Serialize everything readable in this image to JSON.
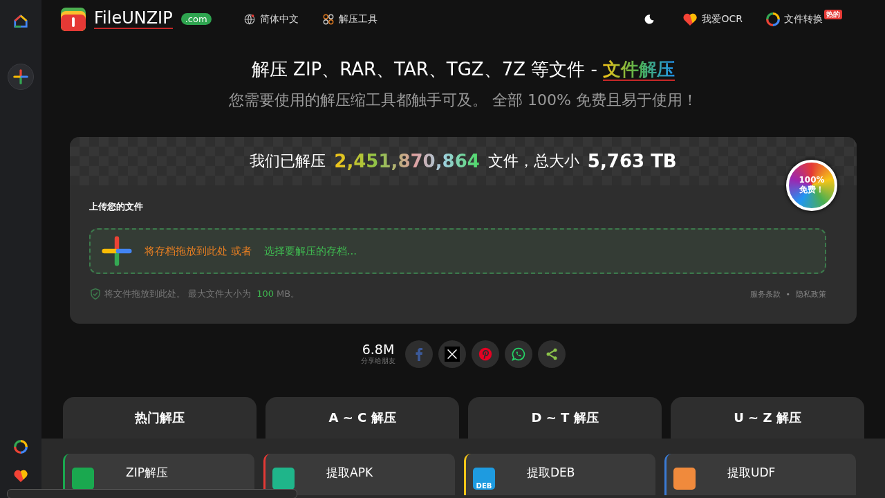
{
  "header": {
    "logo": {
      "name": "FileUNZIP",
      "tld": ".com"
    },
    "nav": [
      {
        "kind": "globe",
        "label": "简体中文"
      },
      {
        "kind": "tools",
        "label": "解压工具"
      }
    ],
    "links": [
      {
        "kind": "heart",
        "label": "我爱OCR"
      },
      {
        "kind": "convert",
        "label": "文件转换",
        "badge": "热的"
      }
    ]
  },
  "hero": {
    "title": "解压 ZIP、RAR、TAR、TGZ、7Z 等文件 - ",
    "highlight": "文件解压",
    "subtitle": "您需要使用的解压缩工具都触手可及。 全部 100% 免费且易于使用！"
  },
  "stats": {
    "prefix": "我们已解压",
    "count": "2,451,870,864",
    "middle": "文件，总大小",
    "size": "5,763 TB"
  },
  "free_badge": {
    "line1": "100%",
    "line2": "免费！"
  },
  "upload": {
    "heading": "上传您的文件",
    "drop": "将存档拖放到此处 或者",
    "choose": "选择要解压的存档...",
    "note": "将文件拖放到此处。 最大文件大小为",
    "max": "100",
    "unit": "MB。",
    "links": [
      "服务条款",
      "隐私政策"
    ],
    "separator": "•"
  },
  "share": {
    "count": "6.8M",
    "label": "分享给朋友",
    "buttons": [
      {
        "kind": "facebook"
      },
      {
        "kind": "x"
      },
      {
        "kind": "pinterest"
      },
      {
        "kind": "whatsapp"
      },
      {
        "kind": "share"
      }
    ]
  },
  "tabs": [
    "热门解压",
    "A ~ C 解压",
    "D ~ T 解压",
    "U ~ Z 解压"
  ],
  "cards": [
    {
      "title": "ZIP解压",
      "color": "#1aa84f",
      "kind": "zip"
    },
    {
      "title": "提取APK",
      "color": "#e53935",
      "kind": "apk"
    },
    {
      "title": "提取DEB",
      "color": "#f5c518",
      "kind": "deb",
      "icon_text": "DEB"
    },
    {
      "title": "提取UDF",
      "color": "#3a7bd5",
      "kind": "udf"
    }
  ]
}
